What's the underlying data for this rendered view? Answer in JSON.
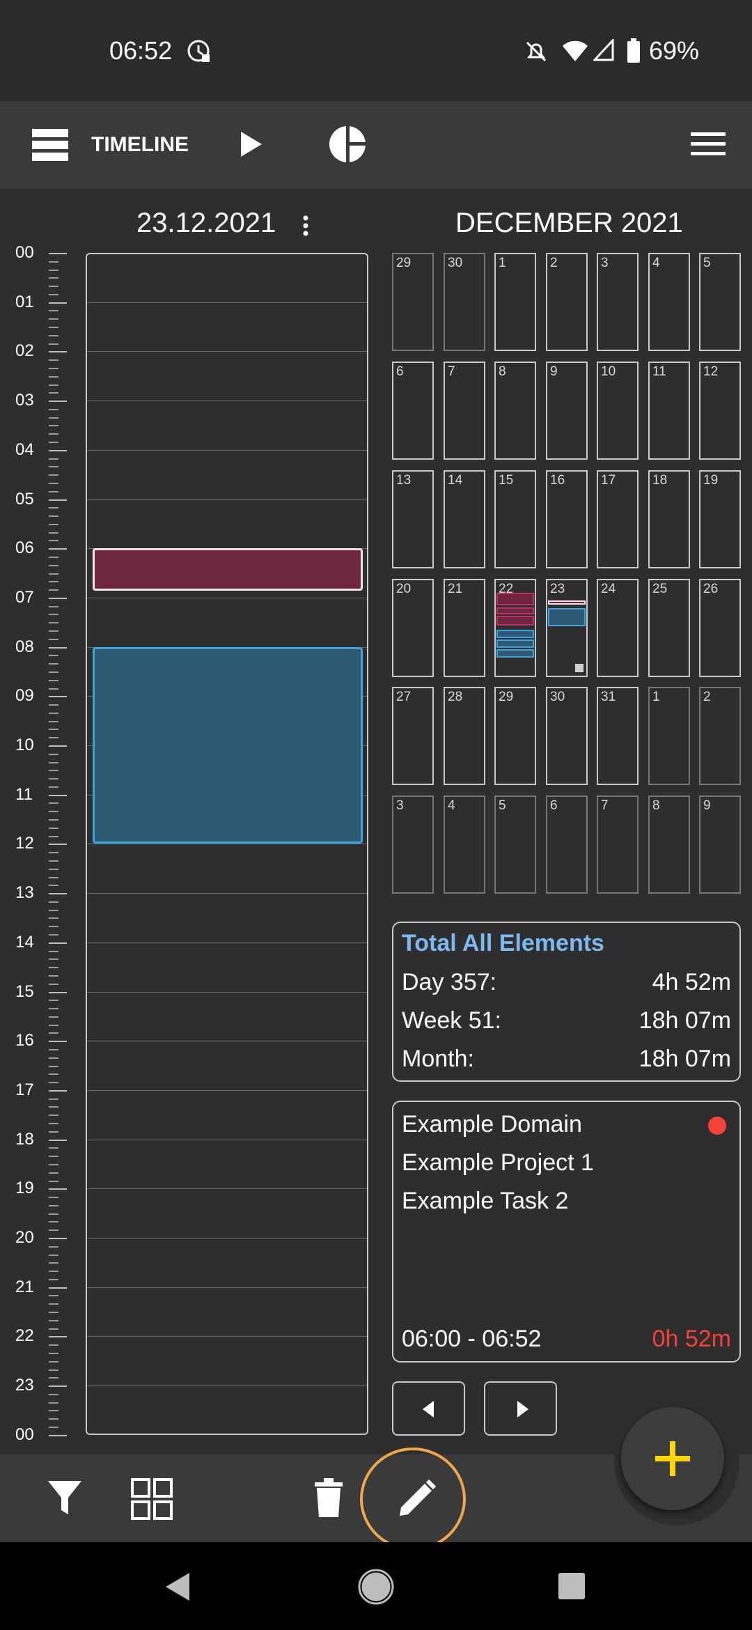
{
  "status": {
    "time": "06:52",
    "battery": "69%"
  },
  "toolbar": {
    "title": "TIMELINE"
  },
  "day_view": {
    "date": "23.12.2021",
    "hours": [
      "00",
      "01",
      "02",
      "03",
      "04",
      "05",
      "06",
      "07",
      "08",
      "09",
      "10",
      "11",
      "12",
      "13",
      "14",
      "15",
      "16",
      "17",
      "18",
      "19",
      "20",
      "21",
      "22",
      "23",
      "00"
    ],
    "events": [
      {
        "start": "06:00",
        "end": "06:52",
        "color": "#6e2640",
        "border": "#f2e6ea"
      },
      {
        "start": "08:00",
        "end": "12:00",
        "color": "#2d5a72",
        "border": "#3ba3e0"
      }
    ]
  },
  "calendar": {
    "month_title": "DECEMBER 2021",
    "weeks": [
      [
        "29",
        "30",
        "1",
        "2",
        "3",
        "4",
        "5"
      ],
      [
        "6",
        "7",
        "8",
        "9",
        "10",
        "11",
        "12"
      ],
      [
        "13",
        "14",
        "15",
        "16",
        "17",
        "18",
        "19"
      ],
      [
        "20",
        "21",
        "22",
        "23",
        "24",
        "25",
        "26"
      ],
      [
        "27",
        "28",
        "29",
        "30",
        "31",
        "1",
        "2"
      ],
      [
        "3",
        "4",
        "5",
        "6",
        "7",
        "8",
        "9"
      ]
    ]
  },
  "totals": {
    "title": "Total All Elements",
    "rows": [
      {
        "label": "Day 357:",
        "value": "4h 52m"
      },
      {
        "label": "Week 51:",
        "value": "18h 07m"
      },
      {
        "label": "Month:",
        "value": "18h 07m"
      }
    ]
  },
  "current": {
    "domain": "Example Domain",
    "project": "Example Project 1",
    "task": "Example Task 2",
    "time_range": "06:00 - 06:52",
    "duration": "0h 52m",
    "status_color": "#f44336"
  },
  "colors": {
    "accent_blue": "#7cb9f0",
    "accent_red": "#f44336",
    "fab_plus": "#ffd600",
    "highlight_ring": "#f0a64a"
  },
  "icons": [
    "layers-icon",
    "play-icon",
    "pie-chart-icon",
    "menu-icon",
    "filter-icon",
    "grid-icon",
    "trash-icon",
    "pencil-icon",
    "plus-icon",
    "chevron-left-icon",
    "chevron-right-icon",
    "more-vert-icon"
  ]
}
